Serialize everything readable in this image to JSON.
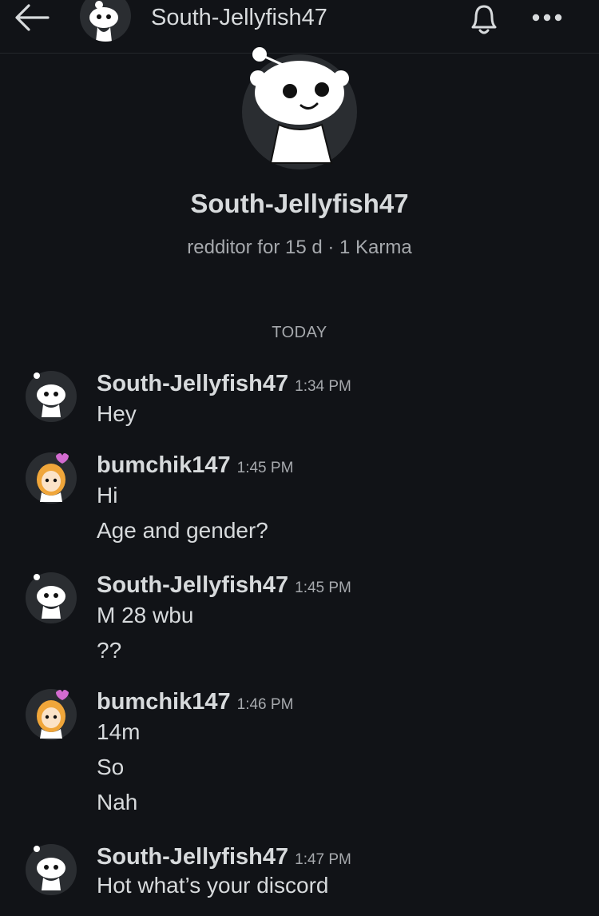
{
  "header": {
    "title": "South-Jellyfish47",
    "icons": [
      "back-arrow-icon",
      "snoo-avatar",
      "bell-icon",
      "more-options-icon"
    ]
  },
  "profile": {
    "name": "South-Jellyfish47",
    "subtitle": "redditor for 15 d · 1 Karma"
  },
  "divider": "TODAY",
  "messages": [
    {
      "author": "South-Jellyfish47",
      "time": "1:34 PM",
      "lines": [
        "Hey"
      ],
      "avatar": "snoo"
    },
    {
      "author": "bumchik147",
      "time": "1:45 PM",
      "lines": [
        "Hi",
        "Age and gender?"
      ],
      "avatar": "orange-hair-avatar"
    },
    {
      "author": "South-Jellyfish47",
      "time": "1:45 PM",
      "lines": [
        "M 28 wbu",
        "??"
      ],
      "avatar": "snoo"
    },
    {
      "author": "bumchik147",
      "time": "1:46 PM",
      "lines": [
        "14m",
        "So",
        "Nah"
      ],
      "avatar": "orange-hair-avatar"
    },
    {
      "author": "South-Jellyfish47",
      "time": "1:47 PM",
      "lines": [
        "Hot what’s your discord"
      ],
      "avatar": "snoo"
    }
  ],
  "colors": {
    "background": "#111317",
    "text": "#d7dadc",
    "muted": "#a6a9ad",
    "avatar_bg": "#2a2d31"
  }
}
